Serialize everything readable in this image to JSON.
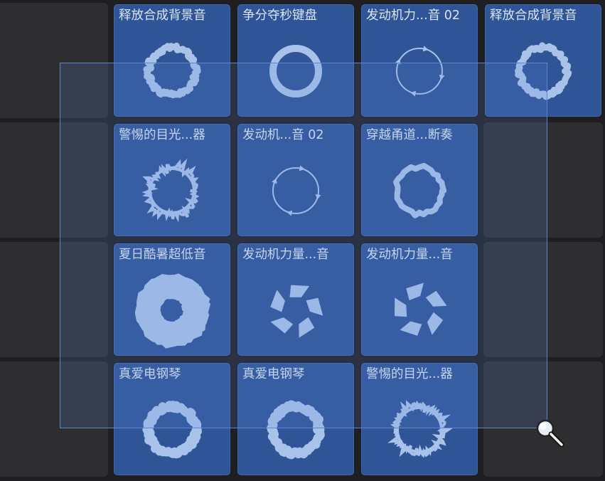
{
  "grid": {
    "rows": [
      [
        {
          "filled": false
        },
        {
          "filled": true,
          "label": "释放合成背景音",
          "icon": "ring-rough"
        },
        {
          "filled": true,
          "label": "争分夺秒键盘",
          "icon": "ring-smooth"
        },
        {
          "filled": true,
          "label": "发动机力...音 02",
          "icon": "ring-arrows"
        },
        {
          "filled": true,
          "label": "释放合成背景音",
          "icon": "ring-rough"
        }
      ],
      [
        {
          "filled": false
        },
        {
          "filled": true,
          "label": "警惕的目光...器",
          "icon": "ring-spiky"
        },
        {
          "filled": true,
          "label": "发动机...音 02",
          "icon": "ring-arrows"
        },
        {
          "filled": true,
          "label": "穿越甬道...断奏",
          "icon": "ring-bumpy"
        },
        {
          "filled": false
        }
      ],
      [
        {
          "filled": false
        },
        {
          "filled": true,
          "label": "夏日酷暑超低音",
          "icon": "donut-thick"
        },
        {
          "filled": true,
          "label": "发动机力量...音",
          "icon": "swirl-blades"
        },
        {
          "filled": true,
          "label": "发动机力量...音",
          "icon": "swirl-blades"
        },
        {
          "filled": false
        }
      ],
      [
        {
          "filled": false
        },
        {
          "filled": true,
          "label": "真爱电钢琴",
          "icon": "ring-rough-thick"
        },
        {
          "filled": true,
          "label": "真爱电钢琴",
          "icon": "ring-rough-thick"
        },
        {
          "filled": true,
          "label": "警惕的目光...器",
          "icon": "ring-spiky"
        },
        {
          "filled": false
        }
      ]
    ]
  },
  "colors": {
    "cell_filled": "#2f5596",
    "cell_empty": "#2e2e31",
    "waveform": "#a9c2ea",
    "selection_border": "#5b86d0"
  },
  "cursor": {
    "icon": "magnifier-zoom-icon"
  }
}
